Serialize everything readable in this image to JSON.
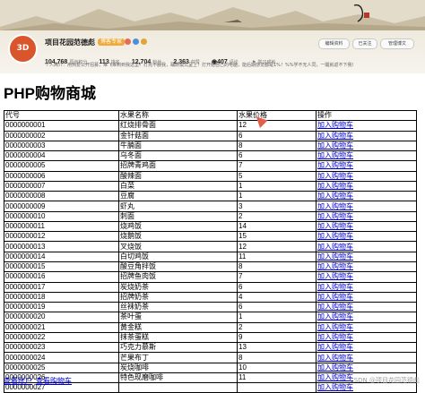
{
  "header": {
    "avatar_text": "3D",
    "blog_name": "项目花园范德彪",
    "badge": "博客专家",
    "stats": [
      {
        "value": "104,768",
        "label": "原创积分"
      },
      {
        "value": "113",
        "label": "排名"
      },
      {
        "value": "12,704",
        "label": "粉丝"
      },
      {
        "value": "2,363",
        "label": "获赞"
      },
      {
        "value": "407",
        "label": "评论"
      },
      {
        "value": "学习成就",
        "label": ""
      }
    ],
    "intro": "个人简介：用热爱公开招募，难飞难到到我这里！打完不服我，踊跃模式呈上！打开给自己的电脑，能后期感觉都是1%！%%学不无人同，一醒就返不下我！",
    "buttons": [
      "编辑资料",
      "已关注",
      "管理博文"
    ]
  },
  "page": {
    "title": "PHP购物商城"
  },
  "table": {
    "headers": [
      "代号",
      "水果名称",
      "水果价格",
      "操作"
    ],
    "action_label": "加入购物车",
    "rows": [
      [
        "0000000001",
        "红烧排骨面",
        "12"
      ],
      [
        "0000000002",
        "金针菇面",
        "6"
      ],
      [
        "0000000003",
        "牛腩面",
        "8"
      ],
      [
        "0000000004",
        "乌冬面",
        "6"
      ],
      [
        "0000000005",
        "招牌青鸡面",
        "7"
      ],
      [
        "0000000006",
        "酸辣面",
        "5"
      ],
      [
        "0000000007",
        "白菜",
        "1"
      ],
      [
        "0000000008",
        "豆腐",
        "1"
      ],
      [
        "0000000009",
        "虾丸",
        "3"
      ],
      [
        "0000000010",
        "刺面",
        "2"
      ],
      [
        "0000000011",
        "烧鸡饭",
        "14"
      ],
      [
        "0000000012",
        "烧鹅饭",
        "15"
      ],
      [
        "0000000013",
        "叉烧饭",
        "12"
      ],
      [
        "0000000014",
        "白切鸡饭",
        "11"
      ],
      [
        "0000000015",
        "酸豆角拌饭",
        "8"
      ],
      [
        "0000000016",
        "招牌鱼肉饭",
        "7"
      ],
      [
        "0000000017",
        "炭烧奶茶",
        "6"
      ],
      [
        "0000000018",
        "招牌奶茶",
        "4"
      ],
      [
        "0000000019",
        "丝袜奶茶",
        "6"
      ],
      [
        "0000000020",
        "茶叶蛋",
        "1"
      ],
      [
        "0000000021",
        "黄金糕",
        "2"
      ],
      [
        "0000000022",
        "抹茶蛋糕",
        "9"
      ],
      [
        "0000000023",
        "巧克力慕斯",
        "13"
      ],
      [
        "0000000024",
        "芒果布丁",
        "8"
      ],
      [
        "0000000025",
        "炭烧咖啡",
        "10"
      ],
      [
        "0000000026",
        "特色现磨咖啡",
        "11"
      ],
      [
        "0000000027",
        "",
        ""
      ]
    ]
  },
  "footer": {
    "link1": "查看账户",
    "link2": "查看购物车"
  },
  "watermark": "CSDN @项目花园范德彪"
}
